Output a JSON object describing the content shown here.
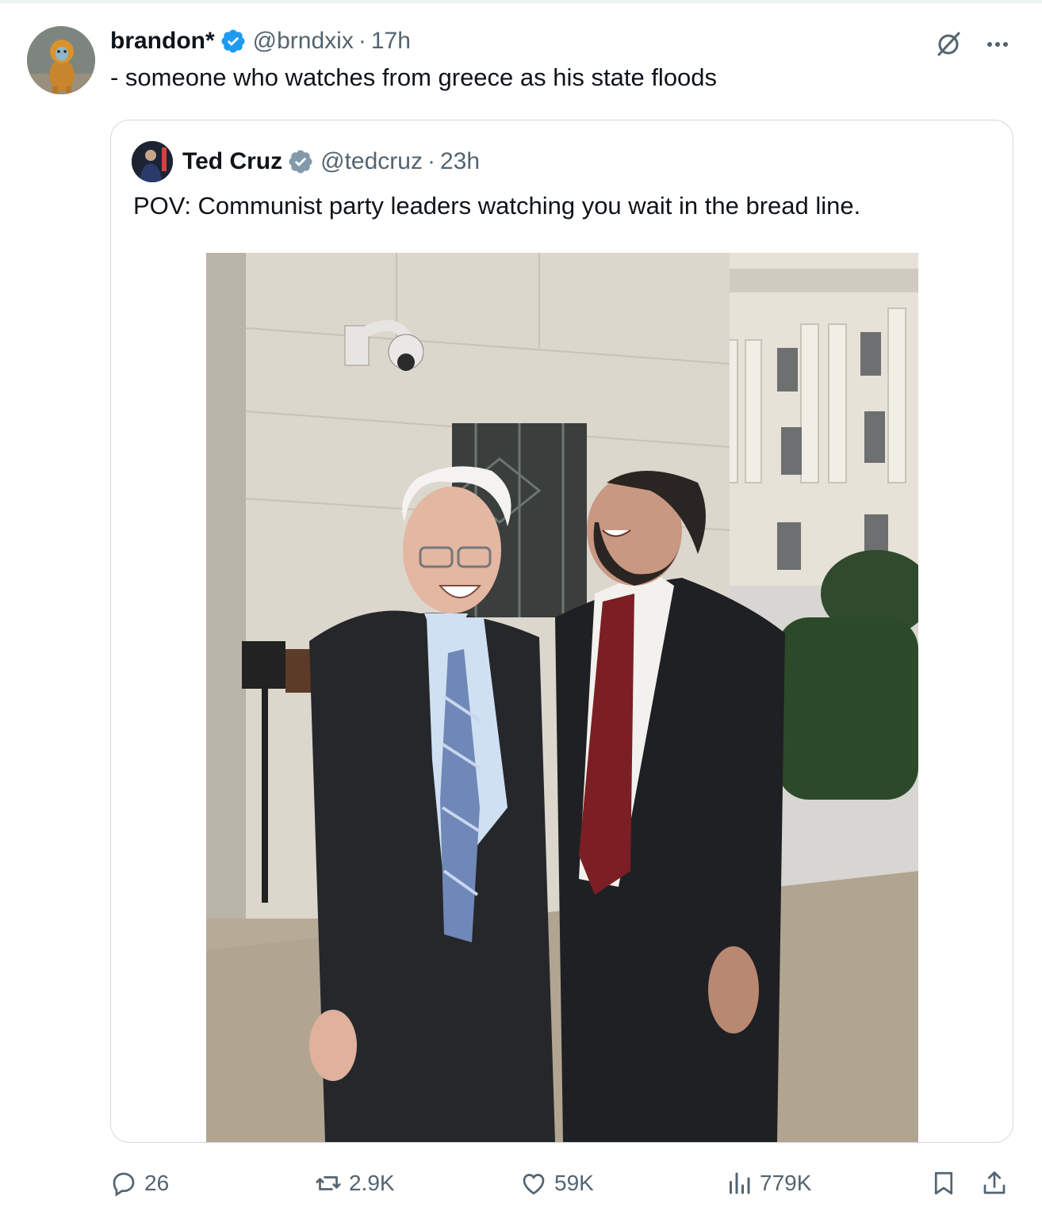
{
  "post": {
    "author_name": "brandon*",
    "handle": "@brndxix",
    "separator": "·",
    "time": "17h",
    "text": "- someone who watches from greece as his state floods",
    "avatar_icon": "monkey-avatar",
    "grok_icon": "grok-icon",
    "more_icon": "more-dots-icon"
  },
  "quoted": {
    "author_name": "Ted Cruz",
    "handle": "@tedcruz",
    "separator": "·",
    "time": "23h",
    "text": "POV: Communist party leaders watching you wait in the bread line.",
    "verified_color": "#829aab"
  },
  "actions": {
    "replies": "26",
    "reposts": "2.9K",
    "likes": "59K",
    "views": "779K"
  },
  "colors": {
    "verified_blue": "#1d9bf0",
    "muted_text": "#536471",
    "border": "#cfd9de"
  }
}
